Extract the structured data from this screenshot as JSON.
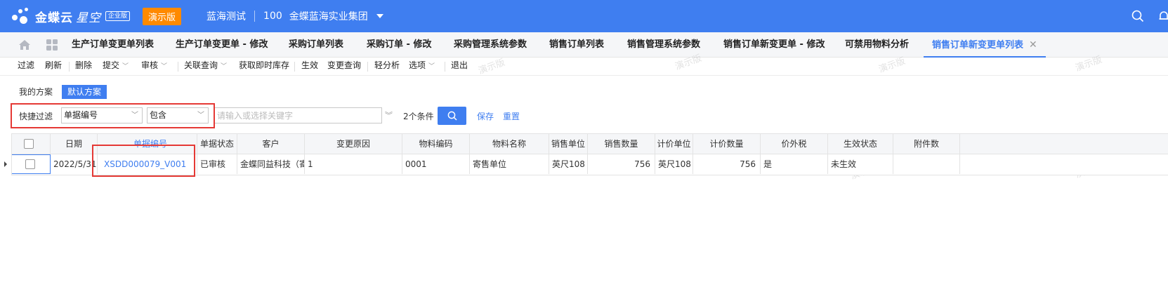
{
  "topbar": {
    "brand": "金蝶云",
    "brand_sub": "星空",
    "edition": "企业版",
    "demo_badge": "演示版",
    "org": "蓝海测试",
    "org_code": "100",
    "org_name": "金蝶蓝海实业集团",
    "color": "#3f7ef0",
    "badge_color": "#ff8a00"
  },
  "tabs": [
    {
      "label": "生产订单变更单列表"
    },
    {
      "label": "生产订单变更单 - 修改"
    },
    {
      "label": "采购订单列表"
    },
    {
      "label": "采购订单 - 修改"
    },
    {
      "label": "采购管理系统参数"
    },
    {
      "label": "销售订单列表"
    },
    {
      "label": "销售管理系统参数"
    },
    {
      "label": "销售订单新变更单 - 修改"
    },
    {
      "label": "可禁用物料分析"
    },
    {
      "label": "销售订单新变更单列表",
      "active": true,
      "close": "✕"
    }
  ],
  "toolbar": {
    "filter": "过滤",
    "refresh": "刷新",
    "delete": "删除",
    "submit": "提交",
    "audit": "审核",
    "related_query": "关联查询",
    "get_stock": "获取即时库存",
    "effect": "生效",
    "change_query": "变更查询",
    "light_analysis": "轻分析",
    "options": "选项",
    "exit": "退出"
  },
  "watermark": "演示版",
  "scheme": {
    "mine": "我的方案",
    "default": "默认方案"
  },
  "filter": {
    "label": "快捷过滤",
    "field": "单据编号",
    "operator": "包含",
    "keyword_placeholder": "请输入或选择关键字",
    "condition_count": "2个条件",
    "save": "保存",
    "reset": "重置"
  },
  "grid": {
    "headers": {
      "date": "日期",
      "bill_no": "单据编号",
      "status": "单据状态",
      "customer": "客户",
      "reason": "变更原因",
      "material_code": "物料编码",
      "material_name": "物料名称",
      "sale_unit": "销售单位",
      "sale_qty": "销售数量",
      "price_unit": "计价单位",
      "price_qty": "计价数量",
      "tax_excl": "价外税",
      "effect_status": "生效状态",
      "attachments": "附件数"
    },
    "rows": [
      {
        "date": "2022/5/31",
        "bill_no": "XSDD000079_V001",
        "status": "已审核",
        "customer": "金蝶同益科技（寄",
        "reason": "1",
        "material_code": "0001",
        "material_name": "寄售单位",
        "sale_unit": "英尺108",
        "sale_qty": "756",
        "price_unit": "英尺108",
        "price_qty": "756",
        "tax_excl": "是",
        "effect_status": "未生效",
        "attachments": ""
      }
    ]
  }
}
